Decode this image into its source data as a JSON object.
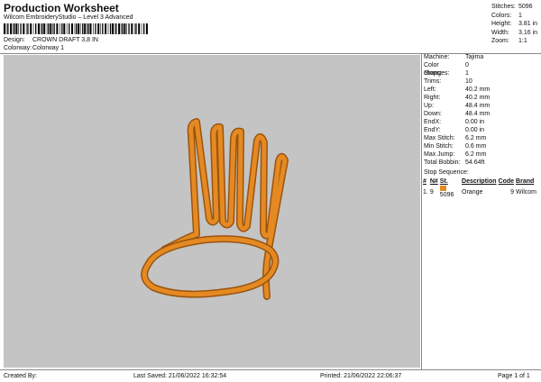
{
  "header": {
    "title": "Production Worksheet",
    "subtitle": "Wilcom EmbroideryStudio – Level 3 Advanced"
  },
  "meta": {
    "design_label": "Design:",
    "design_value": "CROWN DRAFT 3,8 IN",
    "colorway_label": "Colorway:",
    "colorway_value": "Colorway 1"
  },
  "stats": [
    {
      "k": "Stitches:",
      "v": "5096"
    },
    {
      "k": "Colors:",
      "v": "1"
    },
    {
      "k": "Height:",
      "v": "3.81 in"
    },
    {
      "k": "Width:",
      "v": "3.16 in"
    },
    {
      "k": "Zoom:",
      "v": "1:1"
    }
  ],
  "info": [
    {
      "k": "Machine:",
      "v": "Tajima"
    },
    {
      "k": "Color changes:",
      "v": "0"
    },
    {
      "k": "Stops:",
      "v": "1"
    },
    {
      "k": "Trims:",
      "v": "10"
    },
    {
      "k": "Left:",
      "v": "40.2 mm"
    },
    {
      "k": "Right:",
      "v": "40.2 mm"
    },
    {
      "k": "Up:",
      "v": "48.4 mm"
    },
    {
      "k": "Down:",
      "v": "48.4 mm"
    },
    {
      "k": "EndX:",
      "v": "0.00 in"
    },
    {
      "k": "EndY:",
      "v": "0.00 in"
    },
    {
      "k": "Max Stitch:",
      "v": "6.2 mm"
    },
    {
      "k": "Min Stitch:",
      "v": "0.6 mm"
    },
    {
      "k": "Max Jump:",
      "v": "6.2 mm"
    },
    {
      "k": "Total Bobbin:",
      "v": "54.64ft"
    }
  ],
  "stop_sequence": {
    "title": "Stop Sequence:",
    "headers": [
      "#",
      "N#",
      "St.",
      "Description",
      "Code",
      "Brand"
    ],
    "rows": [
      {
        "num": "1.",
        "n": "9",
        "st": "5096",
        "desc": "Orange",
        "code": "9",
        "brand": "Wilcom",
        "color": "#e58a22"
      }
    ]
  },
  "footer": {
    "created": "Created By:",
    "saved": "Last Saved: 21/06/2022 16:32:54",
    "printed": "Printed: 21/06/2022 22:06:37",
    "page": "Page 1 of 1"
  },
  "colors": {
    "thread": "#e58a22",
    "thread_shadow": "#9a5410",
    "canvas": "#c4c4c4"
  }
}
